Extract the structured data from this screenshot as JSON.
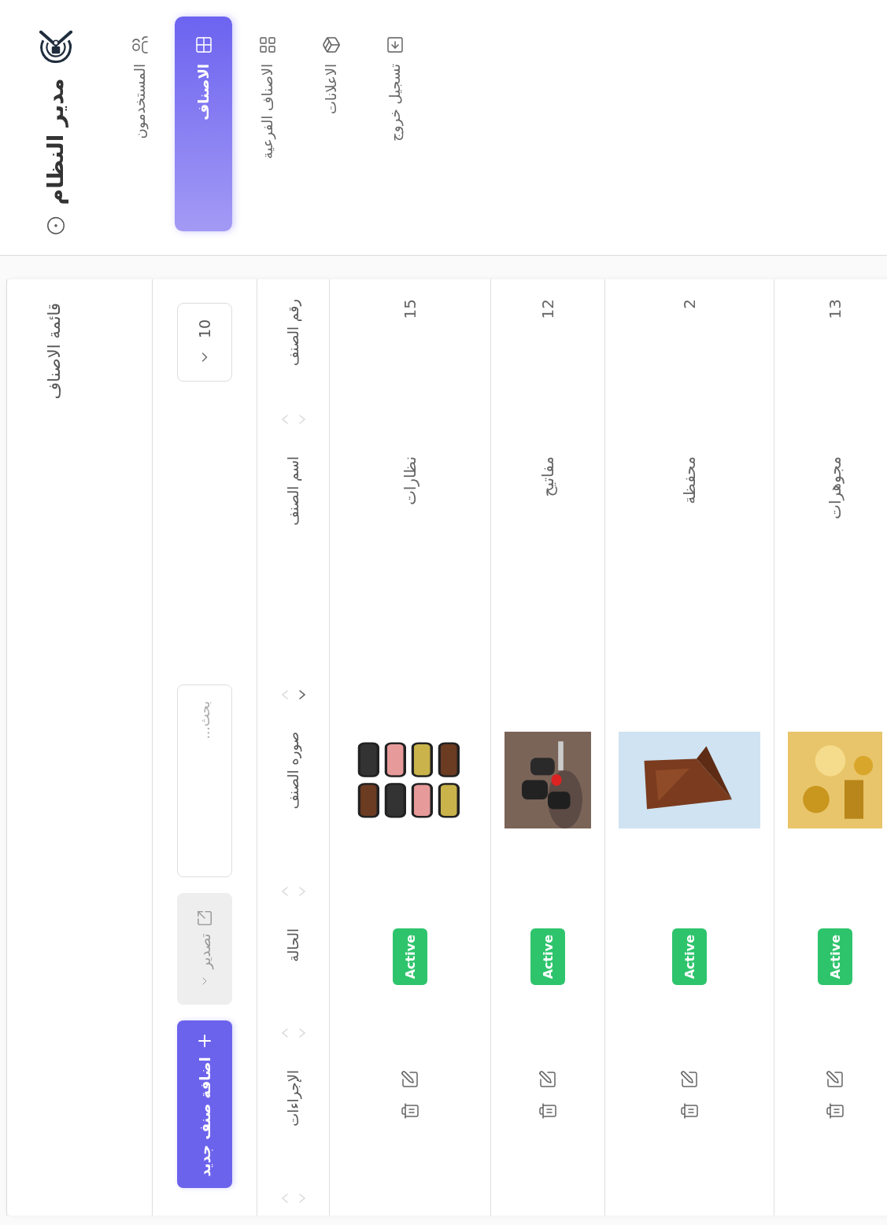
{
  "sidebar": {
    "title": "مدير النظام",
    "items": [
      {
        "label": "المستخدمون",
        "kind": "users",
        "selected": false
      },
      {
        "label": "الاصناف",
        "kind": "table",
        "selected": true
      },
      {
        "label": "الاصناف الفرعية",
        "kind": "grid",
        "selected": false
      },
      {
        "label": "الاعلانات",
        "kind": "box",
        "selected": false
      },
      {
        "label": "تسجيل خروج",
        "kind": "logout",
        "selected": false
      }
    ]
  },
  "card": {
    "title": "قائمة الاصناف"
  },
  "toolbar": {
    "page_size": "10",
    "search": {
      "placeholder": "بحث..."
    },
    "export_button": "تصدير",
    "add_button": "اضافة صنف جديد"
  },
  "table": {
    "columns": [
      {
        "label": "رقم الصنف",
        "sorted": false
      },
      {
        "label": "اسم الصنف",
        "sorted": true
      },
      {
        "label": "صوره الصنف",
        "sorted": false
      },
      {
        "label": "الحالة",
        "sorted": false
      },
      {
        "label": "الإجراءات",
        "sorted": false
      }
    ],
    "rows": [
      {
        "id": "15",
        "name": "نظارات",
        "status": "Active"
      },
      {
        "id": "12",
        "name": "مفاتيح",
        "status": "Active"
      },
      {
        "id": "2",
        "name": "محفظة",
        "status": "Active"
      },
      {
        "id": "13",
        "name": "مجوهرات",
        "status": "Active"
      }
    ]
  }
}
